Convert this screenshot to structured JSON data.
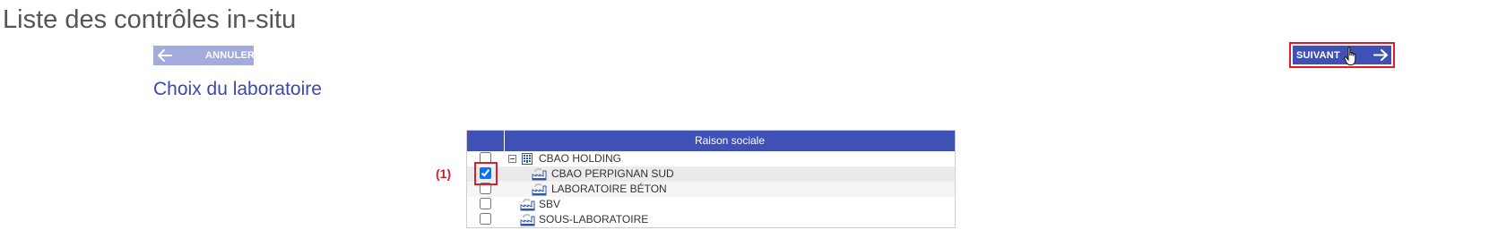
{
  "page": {
    "title": "Liste des contrôles in-situ",
    "section_title": "Choix du laboratoire"
  },
  "toolbar": {
    "cancel_label": "ANNULER",
    "cancel_icon": "arrow-left-icon",
    "next_label": "SUIVANT",
    "next_icon": "arrow-right-icon"
  },
  "colors": {
    "primary": "#3f51b5",
    "primary_light": "#a3aadc",
    "highlight": "#e01b2b",
    "section_title": "#3a48b0"
  },
  "table": {
    "header": {
      "raison_sociale": "Raison sociale"
    },
    "rows": [
      {
        "label": "CBAO HOLDING",
        "icon": "building-icon",
        "expanded": true,
        "checked": false,
        "level": 0
      },
      {
        "label": "CBAO PERPIGNAN SUD",
        "icon": "factory-icon",
        "checked": true,
        "level": 1
      },
      {
        "label": "LABORATOIRE BÉTON",
        "icon": "factory-icon",
        "checked": false,
        "level": 1
      },
      {
        "label": "SBV",
        "icon": "factory-icon",
        "checked": false,
        "level": 0
      },
      {
        "label": "SOUS-LABORATOIRE",
        "icon": "factory-icon",
        "checked": false,
        "level": 0
      }
    ]
  },
  "annotation": {
    "callout": "(1)"
  }
}
